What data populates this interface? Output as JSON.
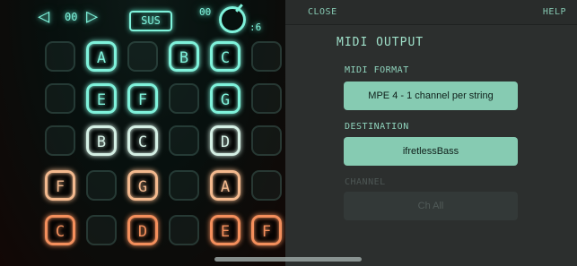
{
  "topbar": {
    "octave_left_icon": "triangle-left",
    "octave_value": "00",
    "octave_right_icon": "triangle-right",
    "sus_label": "SUS",
    "velocity_value": "00",
    "knob_icon": "rotary-knob",
    "knob_value": ":6"
  },
  "grid": {
    "rows": [
      {
        "color": "#7ff2db",
        "cells": [
          "",
          "A",
          "",
          "B",
          "C",
          ""
        ]
      },
      {
        "color": "#7ff2db",
        "cells": [
          "",
          "E",
          "F",
          "",
          "G",
          ""
        ]
      },
      {
        "color": "#d4efe4",
        "cells": [
          "",
          "B",
          "C",
          "",
          "D",
          ""
        ]
      },
      {
        "color": "#f3b98e",
        "cells": [
          "F",
          "",
          "G",
          "",
          "A",
          ""
        ]
      },
      {
        "color": "#f48f5c",
        "cells": [
          "C",
          "",
          "D",
          "",
          "E",
          "F"
        ]
      }
    ]
  },
  "panel": {
    "close_label": "CLOSE",
    "help_label": "HELP",
    "title": "MIDI OUTPUT",
    "midi_format_label": "MIDI FORMAT",
    "midi_format_value": "MPE 4 - 1 channel per string",
    "destination_label": "DESTINATION",
    "destination_value": "ifretlessBass",
    "channel_label": "CHANNEL",
    "channel_value": "Ch All"
  }
}
